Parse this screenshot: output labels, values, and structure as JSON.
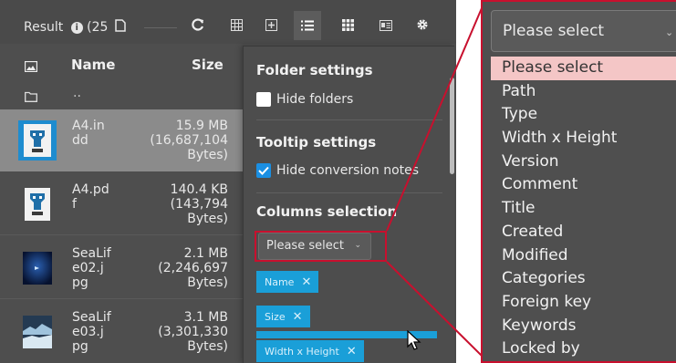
{
  "toolbar": {
    "result_prefix": "Result",
    "result_count": "(25",
    "buttons": [
      "refresh-icon",
      "grid-icon",
      "plus-square-icon",
      "list-icon",
      "thumbnails-icon",
      "card-icon",
      "gear-icon"
    ],
    "active_button": "list-icon"
  },
  "columns": {
    "name": "Name",
    "size": "Size"
  },
  "parent_row": {
    "label": ".."
  },
  "files": [
    {
      "name": "A4.in\ndd",
      "size": "15.9 MB\n(16,687,104\nBytes)",
      "selected": true,
      "thumb": "indesign-doc-thumb"
    },
    {
      "name": "A4.pd\nf",
      "size": "140.4 KB\n(143,794\nBytes)",
      "selected": false,
      "thumb": "pdf-doc-thumb"
    },
    {
      "name": "SeaLif\ne02.j\npg",
      "size": "2.1 MB\n(2,246,697\nBytes)",
      "selected": false,
      "thumb": "sea-photo-thumb"
    },
    {
      "name": "SeaLif\ne03.j\npg",
      "size": "3.1 MB\n(3,301,330\nBytes)",
      "selected": false,
      "thumb": "ice-photo-thumb"
    }
  ],
  "settings": {
    "folder_title": "Folder settings",
    "hide_folders": "Hide folders",
    "hide_folders_checked": false,
    "tooltip_title": "Tooltip settings",
    "hide_notes": "Hide conversion notes",
    "hide_notes_checked": true,
    "columns_title": "Columns selection",
    "select_placeholder": "Please select",
    "chips": [
      "Name",
      "Size",
      "Width x Height"
    ]
  },
  "zoom": {
    "select_value": "Please select",
    "options": [
      "Please select",
      "Path",
      "Type",
      "Width x Height",
      "Version",
      "Comment",
      "Title",
      "Created",
      "Modified",
      "Categories",
      "Foreign key",
      "Keywords",
      "Locked by"
    ],
    "highlighted_option": "Please select"
  },
  "colors": {
    "accent": "#1a9fd8",
    "callout": "#c8102e",
    "highlight": "#f4c6c6"
  }
}
